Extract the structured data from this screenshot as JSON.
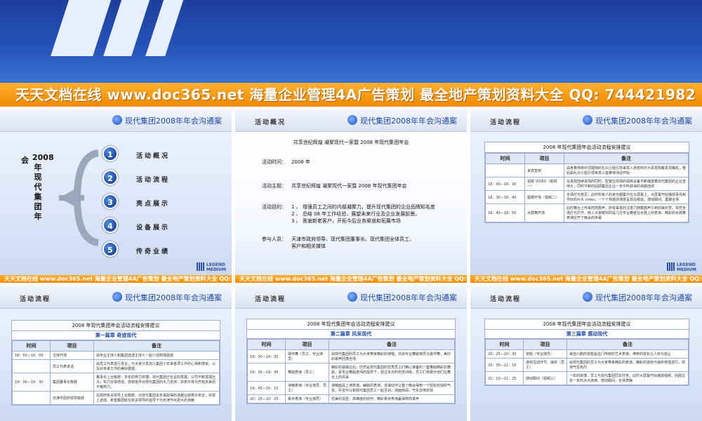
{
  "banner": {
    "big": "天天文档在线  www.doc365.net  海量企业管理4A广告策划  最全地产策划资料大全  QQ: 744421982",
    "small": "天天文档在线  www.doc365.net  海量企业管理4A广告策划  最全地产策划资料大全  QQ: 744421982"
  },
  "header_title": "现代集团2008年年会沟通案",
  "legend": {
    "line1": "LEGEND",
    "line2": "MEDIUM"
  },
  "slide1": {
    "vertical_title": "2008年现代集团年",
    "vertical_sub": "会",
    "items": [
      {
        "num": "1",
        "label": "活动概况"
      },
      {
        "num": "2",
        "label": "活动流程"
      },
      {
        "num": "3",
        "label": "亮点展示"
      },
      {
        "num": "4",
        "label": "设备展示"
      },
      {
        "num": "5",
        "label": "传奇业绩"
      }
    ]
  },
  "slide2": {
    "section": "活动概况",
    "heading": "共享世纪辉煌  凝聚现代一家暨 2008 年现代集团年会",
    "time_label": "活动时间：",
    "time_value": "2008 年",
    "theme_label": "活动主题：",
    "theme_value": "共享世纪辉煌  凝聚现代一家暨 2008 年现代集团年会",
    "goal_label": "活动目的：",
    "goals": [
      "1 、 增强员工之间的内部凝聚力，提升现代集团的企业品牌知名度",
      "2 、 总结 08 年工作经验，展望未来行业及企业发展前景。",
      "3 、 答谢新老客户，开拓今后业务渠道和拓展市场"
    ],
    "people_label": "参与人员：",
    "people": [
      "天津市政府领导、现代集团董事长、现代集团全体员工、",
      "客户和相关媒体"
    ]
  },
  "slide3": {
    "section": "活动流程",
    "table_title": "2008 年现代集团年会活动流程安排建议",
    "headers": [
      "时间",
      "项目",
      "备注"
    ],
    "rows": [
      {
        "time": "",
        "item": "来宾签到",
        "note": "由身着传统中式服饰的礼仪小姐引导来宾入场签到并为贵宾佩戴贵宾胸花，整后由礼仪小姐引领来宾入座等待活动开始"
      },
      {
        "time": "18：00—18：30",
        "item": "视频 VIDEO（视频一）",
        "note": "在来宾陆续进场的同时，配置在现场的视频设备不断播放着现代集团的企业宣传片，同时不断的回顾集团企业一年中所获得的卓越佳绩"
      },
      {
        "time": "18：30—18：40",
        "item": "震撼开场（视频二）",
        "note": "全场灯光熄灭，此时所有人的目光都集中在大屏幕上，大屏幕开始播放事先制作好的片头 video，一个个熟悉的场景呈现在眼前，感动瞬间，震撼全场"
      },
      {
        "time": "18：40—18：50",
        "item": "水鼓舞开场",
        "note": "此时舞台上传来阵阵鼓声，所有来宾的注意力随着鼓声引到前来欣赏，突然全场灯光打开，映入大家眼帘的是几位专业舞者在水鼓上的表演，精彩的水鼓舞表演拉开了晚会的序幕"
      }
    ]
  },
  "slide4": {
    "section": "活动流程",
    "table_title": "2008 年现代集团年会活动流程安排建议",
    "chapter": "第一篇章  奇迹现代",
    "headers": [
      "时间",
      "项目",
      "备注"
    ],
    "rows": [
      {
        "time": "18：50—19：00",
        "item": "主持开场",
        "note": "由专业主持人和集团选送主持人一起介绍到场嘉宾"
      },
      {
        "time": "",
        "item": "员工代表讲话",
        "note": "由员工代表进行发言，与大家分享加入集团十年来各项工作的心得和感受，以及对未来工作的美好展望。"
      },
      {
        "time": "19：00—19：30",
        "item": "集团董事长致辞",
        "note": "董事长上台致辞：多年的努力拼搏，现代集团已长足的发展，公司不断发展壮大，实力日渐增强，感谢各界对现代集团的大力支持，并表示将为开拓未来而不懈努力。"
      },
      {
        "time": "",
        "item": "天津市政府领导致辞",
        "note": "在政府有关领导上台致辞，对现代集团多年来取得的卓越业绩表示肯定，并祝上述成，希望集团能在有关领导的指导下为天津作出更大的贡献"
      }
    ]
  },
  "slide5": {
    "section": "活动流程",
    "table_title": "2008 年现代集团年会活动流程安排建议",
    "chapter": "第二篇章  风采现代",
    "headers": [
      "时间",
      "项目",
      "备注"
    ],
    "rows": [
      {
        "time": "19：30—19：35",
        "item": "歌伴舞（员工、专业演员）",
        "note": "由现代集团的员工为大家带来精彩的演唱，并由专业舞蹈演员为其伴舞，美妙的歌声回荡全场"
      },
      {
        "time": "19：35—19：45",
        "item": "舞蹈表演（员工）",
        "note": "精彩的歌曲过后，仍然是现代集团的优秀员工们精心准备的一套舞蹈精彩的舞蹈，看专业舞蹈老师的指导下，经过多日的刻苦训练，员工们将展示他们在舞台上的风采"
      },
      {
        "time": "19：45—20：15",
        "item": "滑稽表演（专业演员、员工）",
        "note": "滑稽面具上演表演，幽默的表演、诙谐动作让整个晚会得到一个轻松欢快的气氛，并且可以和现代集团员工一起互动，场面热闹，气氛非常欢快"
      },
      {
        "time": "20：15—20：25",
        "item": "柔术表演（专业演员）",
        "note": "优美的造型，高难度的动作，精彩柔术表演赢得阵阵掌声"
      }
    ]
  },
  "slide6": {
    "section": "活动流程",
    "table_title": "2008 年现代集团年会活动流程安排建议",
    "chapter": "第三篇章  感动现代",
    "headers": [
      "时间",
      "项目",
      "备注"
    ],
    "rows": [
      {
        "time": "20：25—20：30",
        "item": "变脸（专业演员）",
        "note": "来自川剧的变脸是这门传统的艺术表演，神奇的变化让人叹为观止"
      },
      {
        "time": "20：30—21：10",
        "item": "游戏互动环节、抽奖（员工）",
        "note": "由现代集团的员工为大家带来精彩的表演，精彩的游戏与抽奖穿插进行，现场气氛热烈"
      },
      {
        "time": "21：10—21：25",
        "item": "感动瞬间（视频三）",
        "note": "一年的拼搏，员工与现代集团同甘共苦，此时大屏幕开始播放视频，回顾过去一年的点点滴滴，感动瞬间，全场肃静"
      }
    ]
  }
}
